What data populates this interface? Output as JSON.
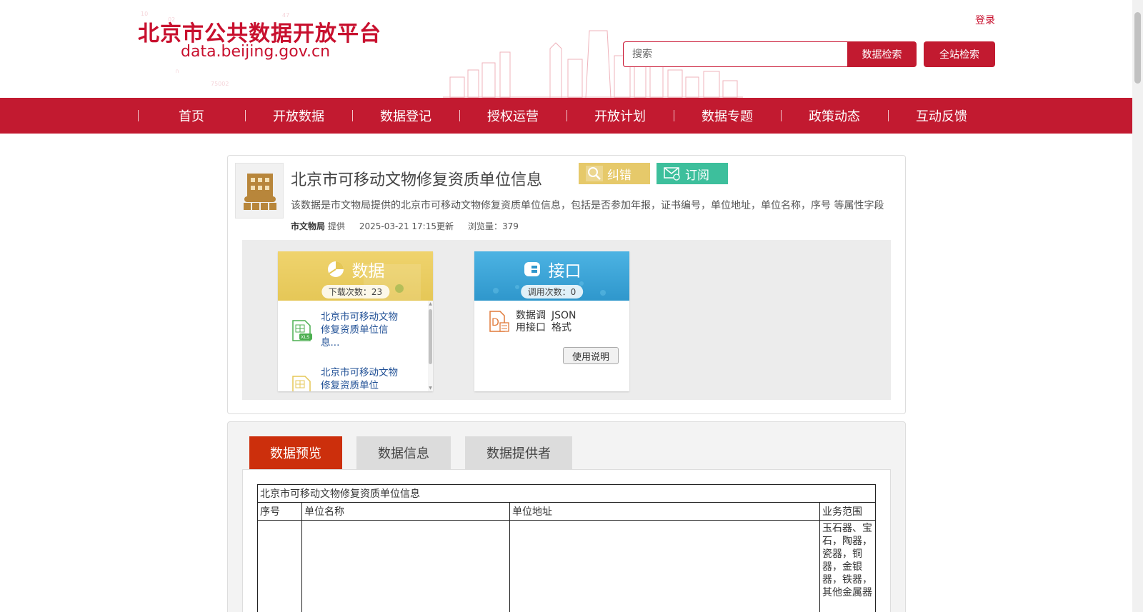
{
  "header": {
    "logo_cn": "北京市公共数据开放平台",
    "logo_url": "data.beijing.gov.cn",
    "login": "登录",
    "search_placeholder": "搜索",
    "data_search": "数据检索",
    "site_search": "全站检索"
  },
  "nav": {
    "items": [
      {
        "label": "首页"
      },
      {
        "label": "开放数据"
      },
      {
        "label": "数据登记"
      },
      {
        "label": "授权运营"
      },
      {
        "label": "开放计划"
      },
      {
        "label": "数据专题"
      },
      {
        "label": "政策动态"
      },
      {
        "label": "互动反馈"
      }
    ]
  },
  "dataset": {
    "title": "北京市可移动文物修复资质单位信息",
    "correct_label": "纠错",
    "subscribe_label": "订阅",
    "description": "该数据是市文物局提供的北京市可移动文物修复资质单位信息，包括是否参加年报，证书编号，单位地址，单位名称，序号 等属性字段",
    "provider": "市文物局",
    "provider_suffix": "提供",
    "updated": "2025-03-21 17:15更新",
    "views": "浏览量：379"
  },
  "data_card": {
    "title": "数据",
    "count": "下载次数：23",
    "files": [
      {
        "name": "北京市可移动文物修复资质单位信息...",
        "type": "XLS"
      },
      {
        "name": "北京市可移动文物修复资质单位",
        "type": "CSV"
      }
    ]
  },
  "api_card": {
    "title": "接口",
    "count": "调用次数：0",
    "api_label_line1": "数据调",
    "api_label_line2": "用接口",
    "format_line1": "JSON",
    "format_line2": "格式",
    "usage_button": "使用说明"
  },
  "tabs": {
    "preview": "数据预览",
    "info": "数据信息",
    "provider": "数据提供者"
  },
  "preview_table": {
    "caption": "北京市可移动文物修复资质单位信息",
    "headers": [
      "序号",
      "单位名称",
      "单位地址",
      "业务范围"
    ],
    "scope_text": "玉石器、宝石，陶器，瓷器，铜器，金银器，铁器，其他金属器"
  },
  "colors": {
    "brand_red": "#c21a30",
    "correct_yellow": "#e6c96a",
    "subscribe_green": "#3dbf9c",
    "tab_active": "#cc2f0c",
    "link_blue": "#1f4f95"
  }
}
